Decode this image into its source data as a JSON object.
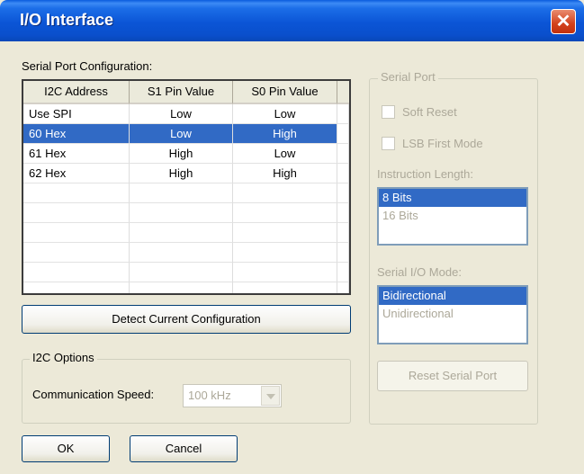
{
  "window": {
    "title": "I/O Interface"
  },
  "serial_config": {
    "label": "Serial Port Configuration:",
    "columns": [
      "I2C Address",
      "S1 Pin Value",
      "S0 Pin Value"
    ],
    "rows": [
      [
        "Use SPI",
        "Low",
        "Low"
      ],
      [
        "60 Hex",
        "Low",
        "High"
      ],
      [
        "61 Hex",
        "High",
        "Low"
      ],
      [
        "62 Hex",
        "High",
        "High"
      ]
    ],
    "selected_row": 1,
    "detect_button": "Detect Current Configuration"
  },
  "i2c_options": {
    "legend": "I2C Options",
    "speed_label": "Communication Speed:",
    "speed_value": "100 kHz"
  },
  "serial_port": {
    "legend": "Serial Port",
    "soft_reset": "Soft Reset",
    "lsb_first": "LSB First Mode",
    "instruction_length_label": "Instruction Length:",
    "instruction_length_options": [
      "8 Bits",
      "16 Bits"
    ],
    "serial_io_mode_label": "Serial I/O Mode:",
    "serial_io_mode_options": [
      "Bidirectional",
      "Unidirectional"
    ],
    "reset_button": "Reset Serial Port"
  },
  "buttons": {
    "ok": "OK",
    "cancel": "Cancel"
  }
}
